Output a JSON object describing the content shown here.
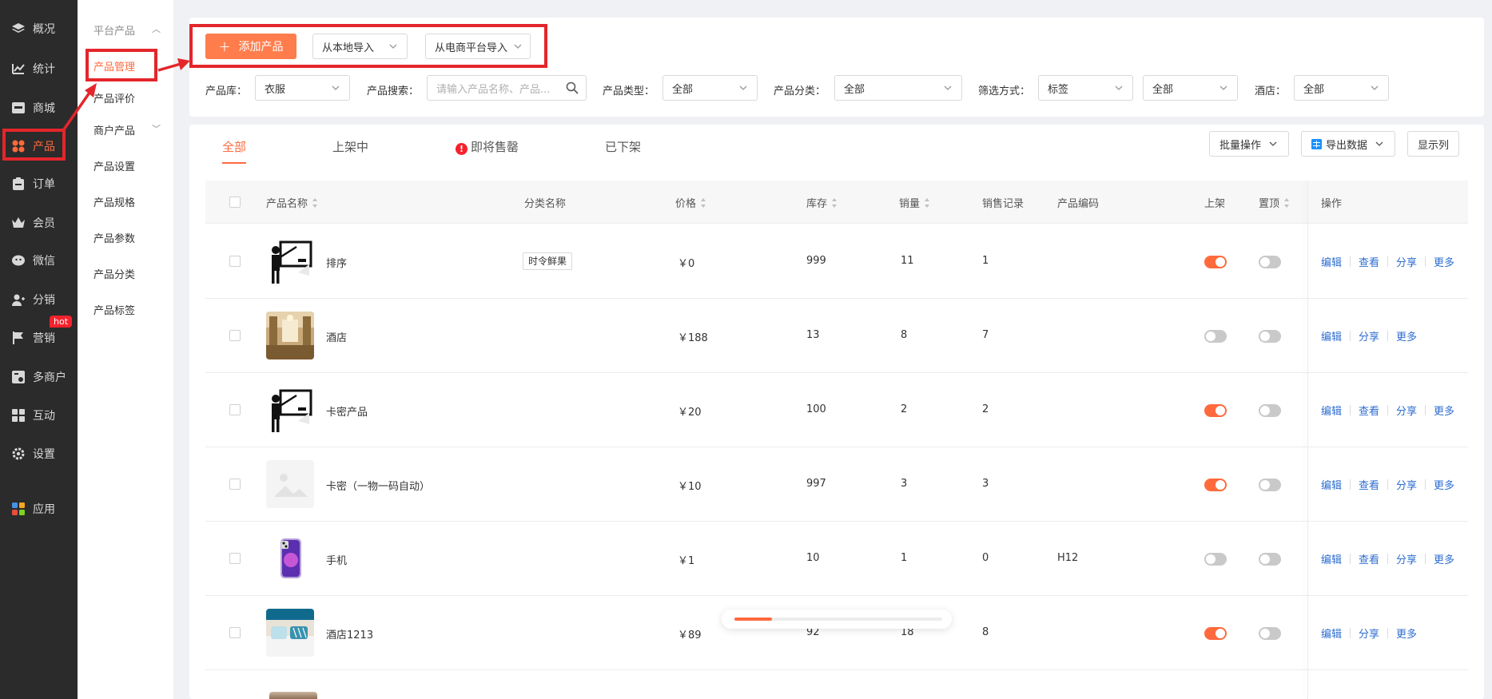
{
  "sidebar": {
    "items": [
      {
        "label": "概况",
        "icon": "layers-icon"
      },
      {
        "label": "统计",
        "icon": "stats-icon"
      },
      {
        "label": "商城",
        "icon": "store-icon"
      },
      {
        "label": "产品",
        "icon": "grid-icon"
      },
      {
        "label": "订单",
        "icon": "order-icon"
      },
      {
        "label": "会员",
        "icon": "crown-icon"
      },
      {
        "label": "微信",
        "icon": "wechat-icon"
      },
      {
        "label": "分销",
        "icon": "user-share-icon"
      },
      {
        "label": "营销",
        "icon": "flag-icon"
      },
      {
        "label": "多商户",
        "icon": "merchant-icon"
      },
      {
        "label": "互动",
        "icon": "interaction-icon"
      },
      {
        "label": "设置",
        "icon": "gear-icon"
      },
      {
        "label": "应用",
        "icon": "apps-icon"
      }
    ],
    "hot_badge": "hot"
  },
  "subnav": {
    "group1": "平台产品",
    "items": [
      "产品管理",
      "产品评价"
    ],
    "group2": "商户产品",
    "items2": [
      "产品设置",
      "产品规格",
      "产品参数",
      "产品分类",
      "产品标签"
    ]
  },
  "toolbar": {
    "add_label": "添加产品",
    "import_local": "从本地导入",
    "import_ecom": "从电商平台导入"
  },
  "filters": {
    "library_label": "产品库：",
    "library_value": "衣服",
    "search_label": "产品搜索：",
    "search_placeholder": "请输入产品名称、产品...",
    "type_label": "产品类型：",
    "type_value": "全部",
    "category_label": "产品分类：",
    "category_value": "全部",
    "filter_label": "筛选方式：",
    "filter_value": "标签",
    "filter_value2": "全部",
    "hotel_label": "酒店：",
    "hotel_value": "全部"
  },
  "tabs": [
    "全部",
    "上架中",
    "即将售罄",
    "已下架"
  ],
  "actions": {
    "batch": "批量操作",
    "export": "导出数据",
    "columns": "显示列"
  },
  "table": {
    "headers": {
      "name": "产品名称",
      "category": "分类名称",
      "price": "价格",
      "stock": "库存",
      "sales": "销量",
      "records": "销售记录",
      "code": "产品编码",
      "listed": "上架",
      "top": "置顶",
      "ops": "操作"
    },
    "rows": [
      {
        "name": "排序",
        "category": "时令鲜果",
        "price": "￥0",
        "stock": "999",
        "sales": "11",
        "records": "1",
        "code": "",
        "listed": true,
        "top": false,
        "ops": [
          "编辑",
          "查看",
          "分享",
          "更多"
        ],
        "thumb": "teacher"
      },
      {
        "name": "酒店",
        "category": "",
        "price": "￥188",
        "stock": "13",
        "sales": "8",
        "records": "7",
        "code": "",
        "listed": false,
        "top": false,
        "ops": [
          "编辑",
          "分享",
          "更多"
        ],
        "thumb": "hotel-lobby"
      },
      {
        "name": "卡密产品",
        "category": "",
        "price": "￥20",
        "stock": "100",
        "sales": "2",
        "records": "2",
        "code": "",
        "listed": true,
        "top": false,
        "ops": [
          "编辑",
          "查看",
          "分享",
          "更多"
        ],
        "thumb": "teacher"
      },
      {
        "name": "卡密（一物一码自动）",
        "category": "",
        "price": "￥10",
        "stock": "997",
        "sales": "3",
        "records": "3",
        "code": "",
        "listed": true,
        "top": false,
        "ops": [
          "编辑",
          "查看",
          "分享",
          "更多"
        ],
        "thumb": "placeholder"
      },
      {
        "name": "手机",
        "category": "",
        "price": "￥1",
        "stock": "10",
        "sales": "1",
        "records": "0",
        "code": "H12",
        "listed": false,
        "top": false,
        "ops": [
          "编辑",
          "查看",
          "分享",
          "更多"
        ],
        "thumb": "phone"
      },
      {
        "name": "酒店1213",
        "category": "",
        "price": "￥89",
        "stock": "92",
        "sales": "18",
        "records": "8",
        "code": "",
        "listed": true,
        "top": false,
        "ops": [
          "编辑",
          "分享",
          "更多"
        ],
        "thumb": "hotel-room"
      }
    ]
  },
  "loading": {
    "progress": 0.18
  },
  "colors": {
    "accent": "#ff6a3d",
    "annotation": "#e3262b",
    "link": "#2d6dd0",
    "nav_bg": "#2b2b2b"
  }
}
